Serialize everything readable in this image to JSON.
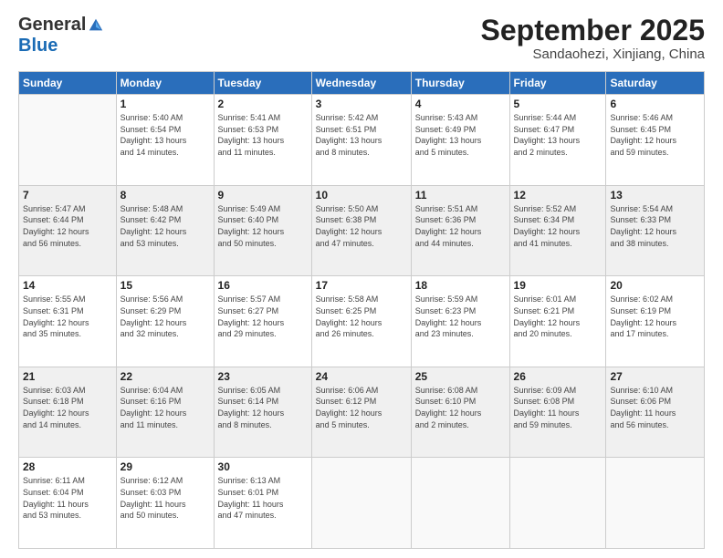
{
  "header": {
    "logo_general": "General",
    "logo_blue": "Blue",
    "month_title": "September 2025",
    "subtitle": "Sandaohezi, Xinjiang, China"
  },
  "days_of_week": [
    "Sunday",
    "Monday",
    "Tuesday",
    "Wednesday",
    "Thursday",
    "Friday",
    "Saturday"
  ],
  "weeks": [
    [
      {
        "day": "",
        "info": ""
      },
      {
        "day": "1",
        "info": "Sunrise: 5:40 AM\nSunset: 6:54 PM\nDaylight: 13 hours\nand 14 minutes."
      },
      {
        "day": "2",
        "info": "Sunrise: 5:41 AM\nSunset: 6:53 PM\nDaylight: 13 hours\nand 11 minutes."
      },
      {
        "day": "3",
        "info": "Sunrise: 5:42 AM\nSunset: 6:51 PM\nDaylight: 13 hours\nand 8 minutes."
      },
      {
        "day": "4",
        "info": "Sunrise: 5:43 AM\nSunset: 6:49 PM\nDaylight: 13 hours\nand 5 minutes."
      },
      {
        "day": "5",
        "info": "Sunrise: 5:44 AM\nSunset: 6:47 PM\nDaylight: 13 hours\nand 2 minutes."
      },
      {
        "day": "6",
        "info": "Sunrise: 5:46 AM\nSunset: 6:45 PM\nDaylight: 12 hours\nand 59 minutes."
      }
    ],
    [
      {
        "day": "7",
        "info": "Sunrise: 5:47 AM\nSunset: 6:44 PM\nDaylight: 12 hours\nand 56 minutes."
      },
      {
        "day": "8",
        "info": "Sunrise: 5:48 AM\nSunset: 6:42 PM\nDaylight: 12 hours\nand 53 minutes."
      },
      {
        "day": "9",
        "info": "Sunrise: 5:49 AM\nSunset: 6:40 PM\nDaylight: 12 hours\nand 50 minutes."
      },
      {
        "day": "10",
        "info": "Sunrise: 5:50 AM\nSunset: 6:38 PM\nDaylight: 12 hours\nand 47 minutes."
      },
      {
        "day": "11",
        "info": "Sunrise: 5:51 AM\nSunset: 6:36 PM\nDaylight: 12 hours\nand 44 minutes."
      },
      {
        "day": "12",
        "info": "Sunrise: 5:52 AM\nSunset: 6:34 PM\nDaylight: 12 hours\nand 41 minutes."
      },
      {
        "day": "13",
        "info": "Sunrise: 5:54 AM\nSunset: 6:33 PM\nDaylight: 12 hours\nand 38 minutes."
      }
    ],
    [
      {
        "day": "14",
        "info": "Sunrise: 5:55 AM\nSunset: 6:31 PM\nDaylight: 12 hours\nand 35 minutes."
      },
      {
        "day": "15",
        "info": "Sunrise: 5:56 AM\nSunset: 6:29 PM\nDaylight: 12 hours\nand 32 minutes."
      },
      {
        "day": "16",
        "info": "Sunrise: 5:57 AM\nSunset: 6:27 PM\nDaylight: 12 hours\nand 29 minutes."
      },
      {
        "day": "17",
        "info": "Sunrise: 5:58 AM\nSunset: 6:25 PM\nDaylight: 12 hours\nand 26 minutes."
      },
      {
        "day": "18",
        "info": "Sunrise: 5:59 AM\nSunset: 6:23 PM\nDaylight: 12 hours\nand 23 minutes."
      },
      {
        "day": "19",
        "info": "Sunrise: 6:01 AM\nSunset: 6:21 PM\nDaylight: 12 hours\nand 20 minutes."
      },
      {
        "day": "20",
        "info": "Sunrise: 6:02 AM\nSunset: 6:19 PM\nDaylight: 12 hours\nand 17 minutes."
      }
    ],
    [
      {
        "day": "21",
        "info": "Sunrise: 6:03 AM\nSunset: 6:18 PM\nDaylight: 12 hours\nand 14 minutes."
      },
      {
        "day": "22",
        "info": "Sunrise: 6:04 AM\nSunset: 6:16 PM\nDaylight: 12 hours\nand 11 minutes."
      },
      {
        "day": "23",
        "info": "Sunrise: 6:05 AM\nSunset: 6:14 PM\nDaylight: 12 hours\nand 8 minutes."
      },
      {
        "day": "24",
        "info": "Sunrise: 6:06 AM\nSunset: 6:12 PM\nDaylight: 12 hours\nand 5 minutes."
      },
      {
        "day": "25",
        "info": "Sunrise: 6:08 AM\nSunset: 6:10 PM\nDaylight: 12 hours\nand 2 minutes."
      },
      {
        "day": "26",
        "info": "Sunrise: 6:09 AM\nSunset: 6:08 PM\nDaylight: 11 hours\nand 59 minutes."
      },
      {
        "day": "27",
        "info": "Sunrise: 6:10 AM\nSunset: 6:06 PM\nDaylight: 11 hours\nand 56 minutes."
      }
    ],
    [
      {
        "day": "28",
        "info": "Sunrise: 6:11 AM\nSunset: 6:04 PM\nDaylight: 11 hours\nand 53 minutes."
      },
      {
        "day": "29",
        "info": "Sunrise: 6:12 AM\nSunset: 6:03 PM\nDaylight: 11 hours\nand 50 minutes."
      },
      {
        "day": "30",
        "info": "Sunrise: 6:13 AM\nSunset: 6:01 PM\nDaylight: 11 hours\nand 47 minutes."
      },
      {
        "day": "",
        "info": ""
      },
      {
        "day": "",
        "info": ""
      },
      {
        "day": "",
        "info": ""
      },
      {
        "day": "",
        "info": ""
      }
    ]
  ]
}
